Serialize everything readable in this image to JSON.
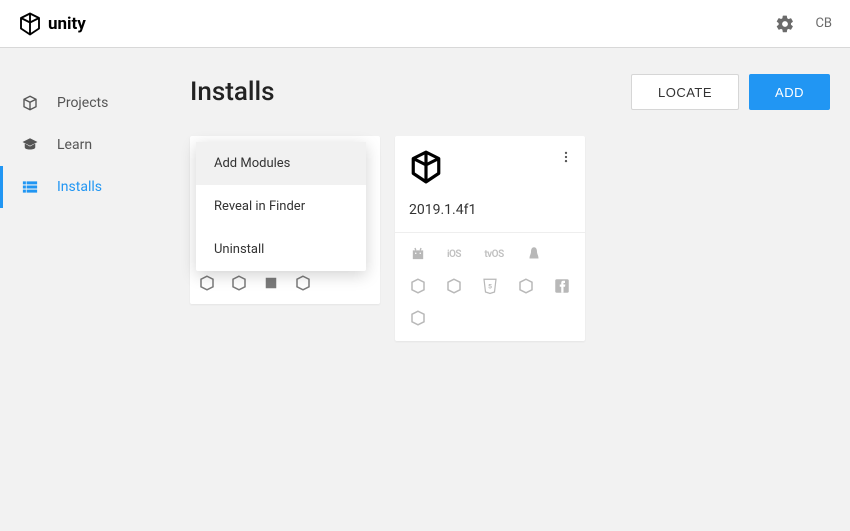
{
  "header": {
    "brand": "unity",
    "user_initials": "CB"
  },
  "sidebar": {
    "items": [
      {
        "label": "Projects"
      },
      {
        "label": "Learn"
      },
      {
        "label": "Installs"
      }
    ]
  },
  "main": {
    "title": "Installs",
    "locate_label": "LOCATE",
    "add_label": "ADD"
  },
  "context_menu": {
    "add_modules": "Add Modules",
    "reveal": "Reveal in Finder",
    "uninstall": "Uninstall"
  },
  "install_card": {
    "version": "2019.1.4f1",
    "platform_ios": "iOS",
    "platform_tvos": "tvOS"
  }
}
